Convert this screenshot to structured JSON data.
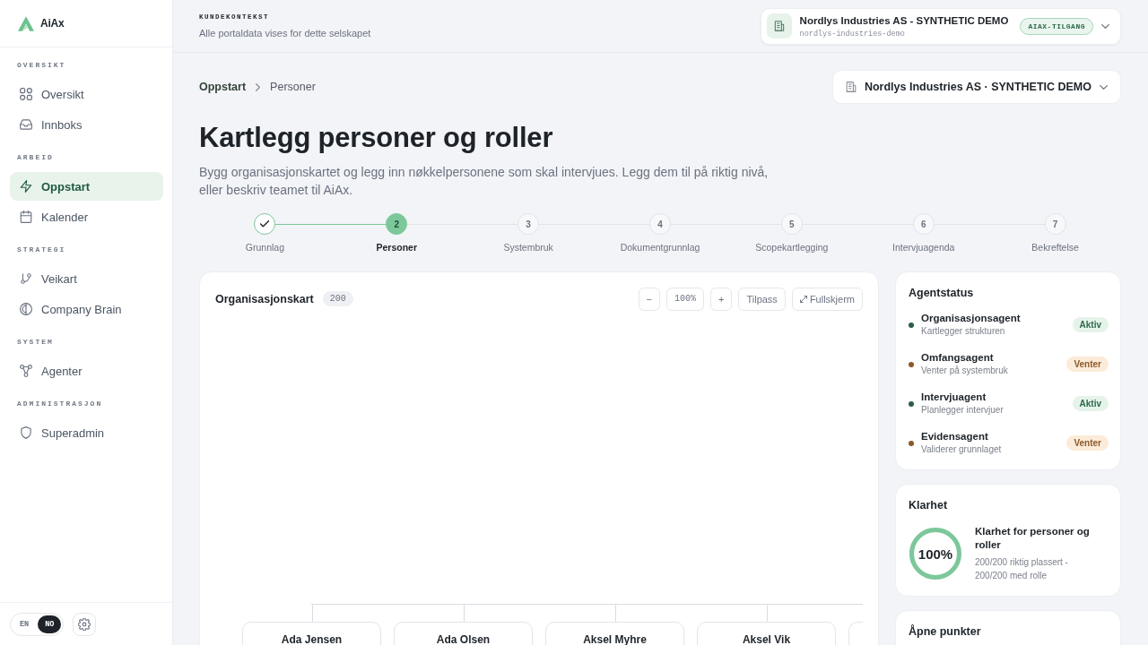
{
  "sidebar": {
    "brand": "AiAx",
    "sections": [
      {
        "label": "OVERSIKT",
        "items": [
          {
            "label": "Oversikt",
            "selected": false
          },
          {
            "label": "Innboks",
            "selected": false
          }
        ]
      },
      {
        "label": "ARBEID",
        "items": [
          {
            "label": "Oppstart",
            "selected": true
          },
          {
            "label": "Kalender",
            "selected": false
          }
        ]
      },
      {
        "label": "STRATEGI",
        "items": [
          {
            "label": "Veikart",
            "selected": false
          },
          {
            "label": "Company Brain",
            "selected": false
          }
        ]
      },
      {
        "label": "SYSTEM",
        "items": [
          {
            "label": "Agenter",
            "selected": false
          }
        ]
      },
      {
        "label": "ADMINISTRASJON",
        "items": [
          {
            "label": "Superadmin",
            "selected": false
          }
        ]
      }
    ],
    "languages": [
      {
        "label": "EN",
        "selected": false
      },
      {
        "label": "NO",
        "selected": true
      }
    ]
  },
  "context_bar": {
    "label": "KUNDEKONTEKST",
    "description": "Alle portaldata vises for dette selskapet",
    "company": {
      "name": "Nordlys Industries AS - SYNTHETIC DEMO",
      "slug": "nordlys-industries-demo",
      "badge": "AIAX-TILGANG"
    }
  },
  "breadcrumb": [
    {
      "label": "Oppstart"
    },
    {
      "label": "Personer"
    }
  ],
  "company_select": {
    "value": "Nordlys Industries AS · SYNTHETIC DEMO"
  },
  "page": {
    "title": "Kartlegg personer og roller",
    "description": "Bygg organisasjonskartet og legg inn nøkkelpersonene som skal intervjues. Legg dem til på riktig nivå, eller beskriv teamet til AiAx."
  },
  "steps": [
    {
      "label": "Grunnlag",
      "completed": true,
      "selected": false
    },
    {
      "number": "2",
      "label": "Personer",
      "completed": false,
      "selected": true
    },
    {
      "number": "3",
      "label": "Systembruk",
      "completed": false,
      "selected": false
    },
    {
      "number": "4",
      "label": "Dokumentgrunnlag",
      "completed": false,
      "selected": false
    },
    {
      "number": "5",
      "label": "Scopekartlegging",
      "completed": false,
      "selected": false
    },
    {
      "number": "6",
      "label": "Intervjuagenda",
      "completed": false,
      "selected": false
    },
    {
      "number": "7",
      "label": "Bekreftelse",
      "completed": false,
      "selected": false
    }
  ],
  "org_chart": {
    "title": "Organisasjonskart",
    "count": "200",
    "zoom_out": "−",
    "zoom_level": "100%",
    "zoom_in": "+",
    "fit": "Tilpass",
    "fullscreen": "Fullskjerm",
    "nodes": [
      {
        "kind": "person",
        "name": "Ada Jensen"
      },
      {
        "kind": "person",
        "name": "Ada Olsen"
      },
      {
        "kind": "person",
        "name": "Aksel Myhre"
      },
      {
        "kind": "person",
        "name": "Aksel Vik"
      },
      {
        "kind": "clipped"
      }
    ]
  },
  "agent_status": {
    "title": "Agentstatus",
    "agents": [
      {
        "name": "Organisasjonsagent",
        "description": "Kartlegger strukturen",
        "status": "Aktiv",
        "active": true,
        "color": "#2e5c47"
      },
      {
        "name": "Omfangsagent",
        "description": "Venter på systembruk",
        "status": "Venter",
        "active": false,
        "color": "#8a5a2b"
      },
      {
        "name": "Intervjuagent",
        "description": "Planlegger intervjuer",
        "status": "Aktiv",
        "active": true,
        "color": "#2e5c47"
      },
      {
        "name": "Evidensagent",
        "description": "Validerer grunnlaget",
        "status": "Venter",
        "active": false,
        "color": "#8a5a2b"
      }
    ]
  },
  "clarity": {
    "title": "Klarhet",
    "level": 1,
    "reading": "100%",
    "heading": "Klarhet for personer og roller",
    "detail": "200/200 riktig plassert - 200/200 med rolle"
  },
  "open_items": {
    "title": "Åpne punkter"
  }
}
